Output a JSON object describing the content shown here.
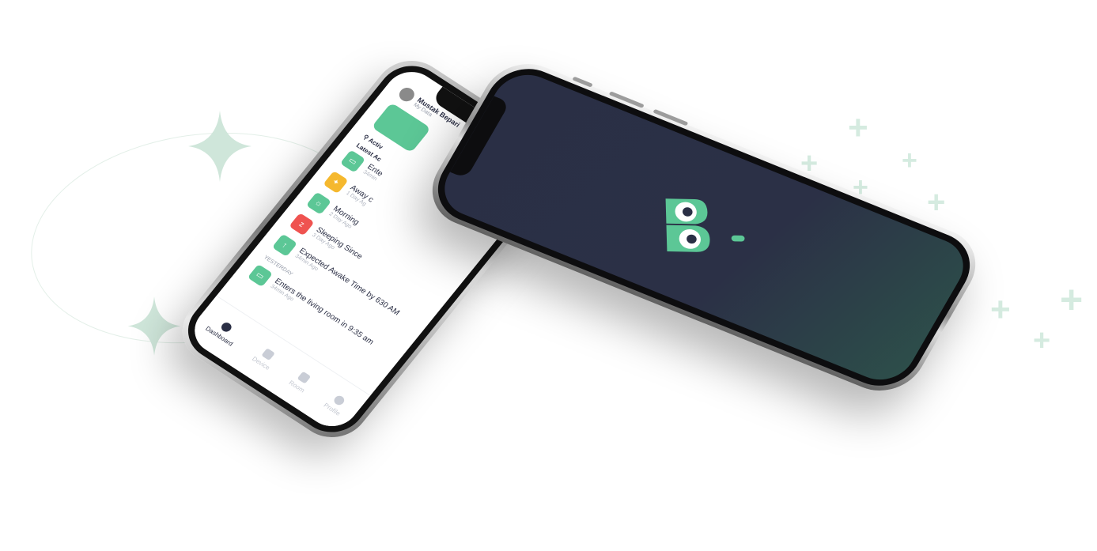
{
  "colors": {
    "accent": "#5cc796",
    "dark_screen": "#2a2f45",
    "text_dark": "#2b2f45",
    "warning": "#f5b82e",
    "alert": "#ef5350"
  },
  "back_phone": {
    "user": {
      "name": "Mustak Bepari",
      "subtitle": "My Data"
    },
    "active_label": "Activ",
    "latest_label": "Latest Ac",
    "activities": [
      {
        "icon": "door-icon",
        "color": "#5cc796",
        "title": "Ente",
        "time": "34min"
      },
      {
        "icon": "walk-icon",
        "color": "#f5b82e",
        "title": "Away c",
        "time": "1 Day Ag"
      },
      {
        "icon": "morning-icon",
        "color": "#5cc796",
        "title": "Morning",
        "time": "2 Day Ago"
      },
      {
        "icon": "sleep-icon",
        "color": "#ef5350",
        "title": "Sleeping Since",
        "time": "3 Day Ago"
      },
      {
        "icon": "awake-icon",
        "color": "#5cc796",
        "title": "Expected Awake Time by 630 AM",
        "time": "34min Ago"
      }
    ],
    "yesterday_label": "YESTERDAY",
    "yesterday_activity": {
      "icon": "door-icon",
      "color": "#5cc796",
      "title": "Enters the living room in 9:35 am",
      "time": "34min Ago"
    },
    "nav": [
      {
        "label": "Dashboard",
        "active": true
      },
      {
        "label": "Device",
        "active": false
      },
      {
        "label": "Room",
        "active": false
      },
      {
        "label": "Profile",
        "active": false
      }
    ]
  }
}
